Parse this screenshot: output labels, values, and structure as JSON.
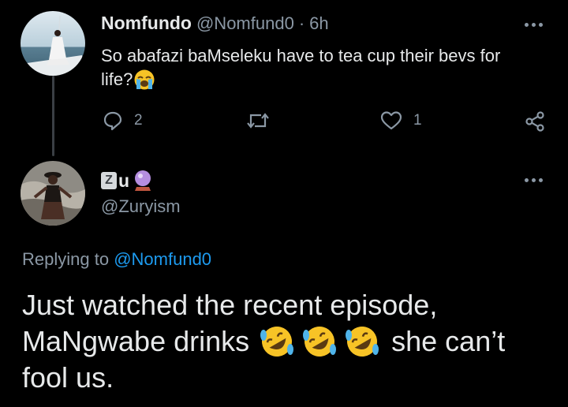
{
  "parent_tweet": {
    "display_name": "Nomfundo",
    "handle": "@Nomfund0",
    "separator": "·",
    "time": "6h",
    "text": "So abafazi baMseleku have to tea cup their bevs for",
    "text_line2": "life?",
    "emoji_icon": "loudly-crying-face-emoji",
    "reply_count": "2",
    "like_count": "1",
    "icons": [
      "reply-icon",
      "retweet-icon",
      "like-icon",
      "share-icon",
      "more-icon"
    ]
  },
  "reply_tweet": {
    "display_name_badge": "Z",
    "display_name_letter": "u",
    "display_name_emoji": "crystal-ball-emoji",
    "handle": "@Zuryism",
    "replying_prefix": "Replying to",
    "replying_handle": "@Nomfund0",
    "text_line1": "Just watched the recent episode,",
    "text_line2_a": "MaNgwabe drinks",
    "text_line2_b": "she can’t",
    "text_line3": "fool us.",
    "emoji_icons": [
      "rolling-on-floor-laughing-emoji",
      "rolling-on-floor-laughing-emoji",
      "rolling-on-floor-laughing-emoji"
    ]
  },
  "colors": {
    "background": "#000000",
    "text": "#e7e9ea",
    "muted": "#8b98a5",
    "link": "#1d9bf0"
  }
}
